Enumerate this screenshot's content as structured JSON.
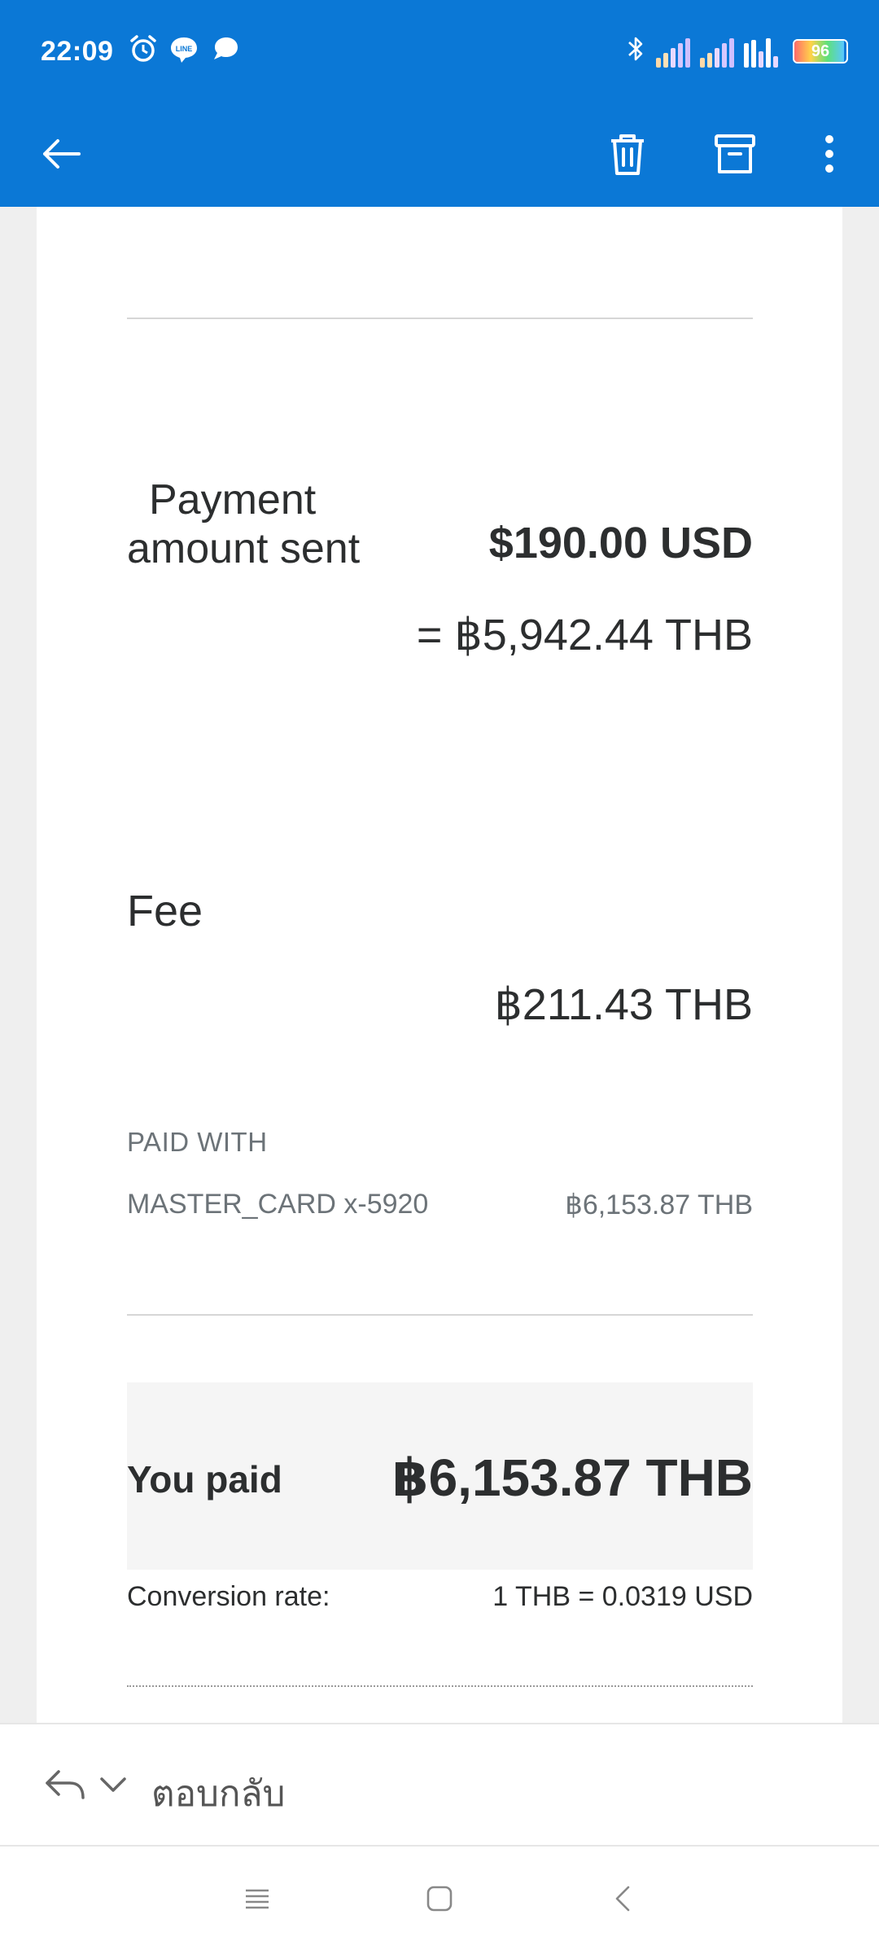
{
  "status_bar": {
    "time": "22:09",
    "battery_level": "96",
    "icons": [
      "alarm-icon",
      "line-icon",
      "chat-bubble-icon",
      "bluetooth-icon",
      "signal-icon",
      "signal-icon",
      "signal-icon",
      "battery-icon"
    ]
  },
  "toolbar": {
    "icons": [
      "back-arrow-icon",
      "trash-icon",
      "archive-icon",
      "more-vert-icon"
    ],
    "accent_color": "#0b78d6"
  },
  "payment": {
    "label_line1": "Payment",
    "label_line2": "amount sent",
    "amount_usd": "$190.00 USD",
    "amount_thb": "= ฿5,942.44 THB"
  },
  "fee": {
    "label": "Fee",
    "amount": "฿211.43 THB"
  },
  "paid_with": {
    "heading": "PAID WITH",
    "card": "MASTER_CARD x-5920",
    "amount": "฿6,153.87 THB"
  },
  "total": {
    "label": "You paid",
    "amount": "฿6,153.87 THB"
  },
  "conversion": {
    "label": "Conversion rate:",
    "value": "1 THB = 0.0319 USD"
  },
  "reply_bar": {
    "label": "ตอบกลับ"
  },
  "nav": {
    "icons": [
      "recents-icon",
      "home-icon",
      "back-icon"
    ]
  }
}
